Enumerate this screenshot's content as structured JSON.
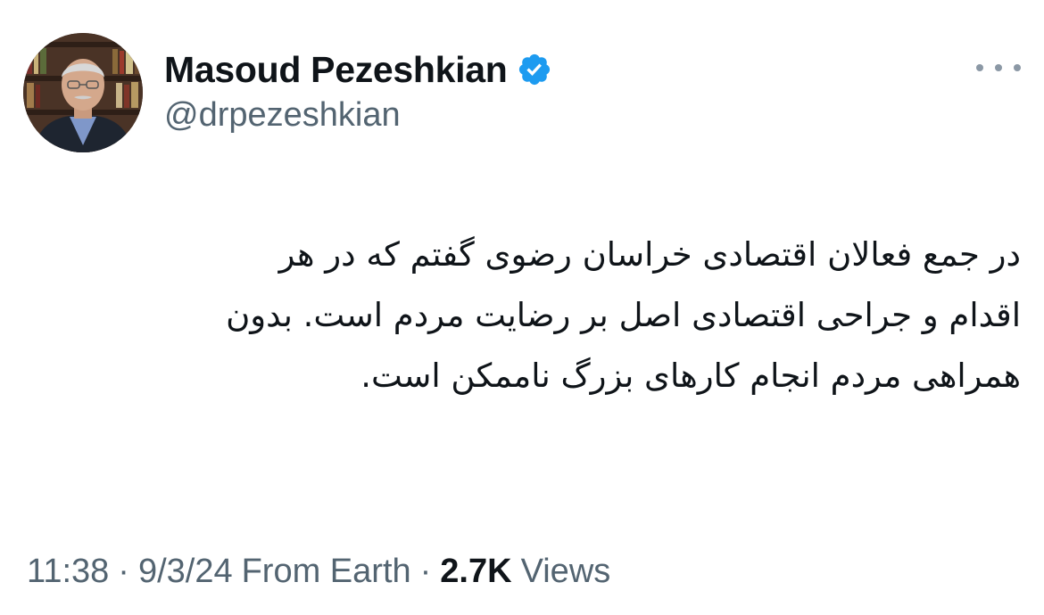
{
  "author": {
    "display_name": "Masoud Pezeshkian",
    "handle": "@drpezeshkian",
    "verified": true,
    "verified_color": "#1d9bf0"
  },
  "tweet": {
    "lines": [
      "در جمع فعالان اقتصادی خراسان رضوی گفتم که در هر",
      "اقدام و جراحی اقتصادی اصل بر رضایت مردم است. بدون",
      "همراهی مردم انجام کارهای بزرگ ناممکن است."
    ]
  },
  "meta": {
    "time": "11:38",
    "date": "9/3/24",
    "source": "From Earth",
    "separator": "·",
    "views_count": "2.7K",
    "views_label": "Views"
  },
  "icons": {
    "more": "more-horizontal-icon",
    "verified": "verified-badge-icon"
  }
}
